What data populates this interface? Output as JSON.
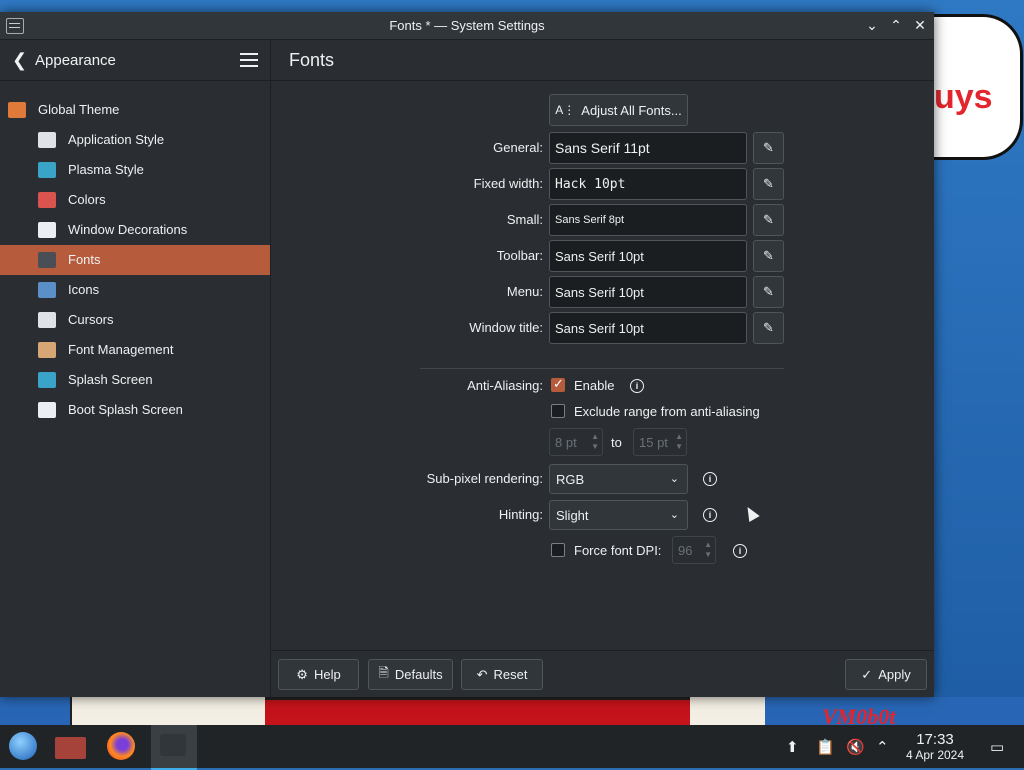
{
  "window": {
    "title": "Fonts * — System Settings"
  },
  "sidebar": {
    "heading": "Appearance",
    "items": [
      {
        "label": "Global Theme",
        "icon": "global-theme-icon",
        "color": "#e07a3a"
      },
      {
        "label": "Application Style",
        "icon": "application-style-icon",
        "color": "#dfe3e6"
      },
      {
        "label": "Plasma Style",
        "icon": "plasma-style-icon",
        "color": "#3aa3c8"
      },
      {
        "label": "Colors",
        "icon": "colors-icon",
        "color": "#d9534f"
      },
      {
        "label": "Window Decorations",
        "icon": "window-decorations-icon",
        "color": "#eceff1"
      },
      {
        "label": "Fonts",
        "icon": "fonts-icon",
        "color": "#4a4f55"
      },
      {
        "label": "Icons",
        "icon": "icons-icon",
        "color": "#5a8fc8"
      },
      {
        "label": "Cursors",
        "icon": "cursors-icon",
        "color": "#dfe3e6"
      },
      {
        "label": "Font Management",
        "icon": "font-management-icon",
        "color": "#d7a675"
      },
      {
        "label": "Splash Screen",
        "icon": "splash-screen-icon",
        "color": "#3aa3c8"
      },
      {
        "label": "Boot Splash Screen",
        "icon": "boot-splash-screen-icon",
        "color": "#eceff1"
      }
    ],
    "active_index": 5
  },
  "main": {
    "heading": "Fonts",
    "adjust_all_label": "Adjust All Fonts...",
    "font_rows": [
      {
        "label": "General:",
        "value": "Sans Serif 11pt"
      },
      {
        "label": "Fixed width:",
        "value": "Hack 10pt"
      },
      {
        "label": "Small:",
        "value": "Sans Serif 8pt"
      },
      {
        "label": "Toolbar:",
        "value": "Sans Serif 10pt"
      },
      {
        "label": "Menu:",
        "value": "Sans Serif 10pt"
      },
      {
        "label": "Window title:",
        "value": "Sans Serif 10pt"
      }
    ],
    "antialiasing_label": "Anti-Aliasing:",
    "enable_label": "Enable",
    "enable_checked": true,
    "exclude_label": "Exclude range from anti-aliasing",
    "exclude_checked": false,
    "range_from": "8 pt",
    "range_to_label": "to",
    "range_to": "15 pt",
    "subpixel_label": "Sub-pixel rendering:",
    "subpixel_value": "RGB",
    "hinting_label": "Hinting:",
    "hinting_value": "Slight",
    "force_dpi_label": "Force font DPI:",
    "force_dpi_checked": false,
    "force_dpi_value": "96"
  },
  "footer": {
    "help_label": "Help",
    "defaults_label": "Defaults",
    "reset_label": "Reset",
    "apply_label": "Apply"
  },
  "taskbar": {
    "time": "17:33",
    "date": "4 Apr 2024"
  },
  "wallpaper": {
    "text": "uys",
    "signature": "VM0b0t"
  },
  "colors": {
    "accent": "#b65b3c",
    "window_bg": "#2a2e32",
    "text": "#eff0f1"
  }
}
